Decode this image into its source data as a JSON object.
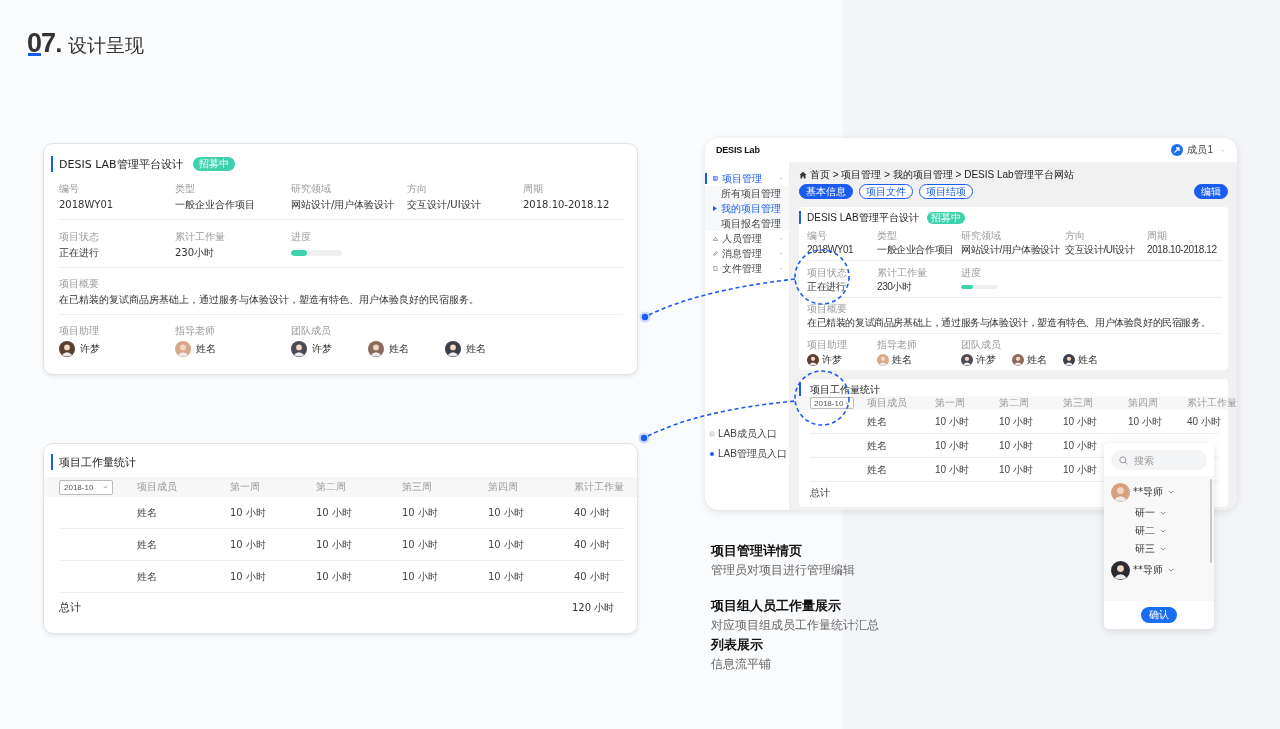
{
  "header": {
    "number": "07",
    "dot": ".",
    "title": "设计呈现"
  },
  "detail_card": {
    "title": "DESIS LAB管理平台设计",
    "badge": "招募中",
    "fields": [
      [
        {
          "kind": "text",
          "label": "编号",
          "value": "2018WY01"
        },
        {
          "kind": "text",
          "label": "类型",
          "value": "一般企业合作项目"
        },
        {
          "kind": "text",
          "label": "研究领域",
          "value": "网站设计/用户体验设计"
        },
        {
          "kind": "text",
          "label": "方向",
          "value": "交互设计/UI设计"
        },
        {
          "kind": "text",
          "label": "周期",
          "value": "2018.10-2018.12"
        }
      ],
      [
        {
          "kind": "text",
          "label": "项目状态",
          "value": "正在进行"
        },
        {
          "kind": "text",
          "label": "累计工作量",
          "value": "230小时"
        },
        {
          "kind": "progress",
          "label": "进度",
          "level": 0.32
        }
      ]
    ],
    "summary": {
      "label": "项目概要",
      "text": "在已精装的复试商品房基础上，通过服务与体验设计，塑造有特色、用户体验良好的民宿服务。"
    },
    "people": [
      {
        "label": "项目助理",
        "members": [
          {
            "name": "许梦"
          }
        ]
      },
      {
        "label": "指导老师",
        "members": [
          {
            "name": "姓名"
          }
        ]
      },
      {
        "label": "团队成员",
        "members": [
          {
            "name": "许梦"
          },
          {
            "name": "姓名"
          },
          {
            "name": "姓名"
          }
        ]
      }
    ]
  },
  "workload_card": {
    "title": "项目工作量统计",
    "month": "2018-10",
    "columns": [
      "项目成员",
      "第一周",
      "第二周",
      "第三周",
      "第四周",
      "累计工作量"
    ],
    "rows": [
      {
        "member": "姓名",
        "weeks": [
          "10 小时",
          "10 小时",
          "10 小时",
          "10 小时"
        ],
        "total": "40 小时"
      },
      {
        "member": "姓名",
        "weeks": [
          "10 小时",
          "10 小时",
          "10 小时",
          "10 小时"
        ],
        "total": "40 小时"
      },
      {
        "member": "姓名",
        "weeks": [
          "10 小时",
          "10 小时",
          "10 小时",
          "10 小时"
        ],
        "total": "40 小时"
      }
    ],
    "total_label": "总计",
    "total_value": "120 小时"
  },
  "app": {
    "logo": "DESIS Lab",
    "user": "成员1",
    "menu": [
      {
        "label": "项目管理",
        "selected": true,
        "expanded": true,
        "children": [
          {
            "label": "所有项目管理",
            "selected": false
          },
          {
            "label": "我的项目管理",
            "selected": true
          },
          {
            "label": "项目报名管理",
            "selected": false
          }
        ]
      },
      {
        "label": "人员管理",
        "selected": false,
        "expanded": false
      },
      {
        "label": "消息管理",
        "selected": false,
        "expanded": false
      },
      {
        "label": "文件管理",
        "selected": false,
        "expanded": false
      }
    ],
    "entries": [
      {
        "label": "LAB成员入口",
        "selected": false
      },
      {
        "label": "LAB管理员入口",
        "selected": true
      }
    ],
    "breadcrumb": "首页 > 项目管理 > 我的项目管理 > DESIS Lab管理平台网站",
    "tabs": [
      {
        "label": "基本信息",
        "selected": true
      },
      {
        "label": "项目文件",
        "selected": false
      },
      {
        "label": "项目结项",
        "selected": false
      }
    ],
    "edit_button": "编辑",
    "detail_card": {
      "title": "DESIS LAB管理平台设计",
      "badge": "招募中",
      "fields": [
        [
          {
            "kind": "text",
            "label": "编号",
            "value": "2018WY01"
          },
          {
            "kind": "text",
            "label": "类型",
            "value": "一般企业合作项目"
          },
          {
            "kind": "text",
            "label": "研究领域",
            "value": "网站设计/用户体验设计"
          },
          {
            "kind": "text",
            "label": "方向",
            "value": "交互设计/UI设计"
          },
          {
            "kind": "text",
            "label": "周期",
            "value": "2018.10-2018.12"
          }
        ],
        [
          {
            "kind": "text",
            "label": "项目状态",
            "value": "正在进行"
          },
          {
            "kind": "text",
            "label": "累计工作量",
            "value": "230小时"
          },
          {
            "kind": "progress",
            "label": "进度",
            "level": 0.32
          }
        ]
      ],
      "summary": {
        "label": "项目概要",
        "text": "在已精装的复试商品房基础上，通过服务与体验设计，塑造有特色、用户体验良好的民宿服务。"
      },
      "people": [
        {
          "label": "项目助理",
          "members": [
            {
              "name": "许梦"
            }
          ]
        },
        {
          "label": "指导老师",
          "members": [
            {
              "name": "姓名"
            }
          ]
        },
        {
          "label": "团队成员",
          "members": [
            {
              "name": "许梦"
            },
            {
              "name": "姓名"
            },
            {
              "name": "姓名"
            }
          ]
        }
      ]
    },
    "workload_card": {
      "title": "项目工作量统计",
      "month": "2018-10",
      "columns": [
        "项目成员",
        "第一周",
        "第二周",
        "第三周",
        "第四周",
        "累计工作量"
      ],
      "rows": [
        {
          "member": "姓名",
          "weeks": [
            "10 小时",
            "10 小时",
            "10 小时",
            "10 小时"
          ],
          "total": "40 小时"
        },
        {
          "member": "姓名",
          "weeks": [
            "10 小时",
            "10 小时",
            "10 小时"
          ]
        },
        {
          "member": "姓名",
          "weeks": [
            "10 小时",
            "10 小时",
            "10 小时"
          ]
        }
      ],
      "total_label": "总计"
    }
  },
  "member_picker": {
    "search_placeholder": "搜索",
    "teachers": [
      {
        "name": "**导师",
        "children": [
          {
            "label": "研一"
          },
          {
            "label": "研二"
          },
          {
            "label": "研三"
          }
        ]
      },
      {
        "name": "**导师"
      }
    ],
    "confirm": "确认"
  },
  "captions": [
    {
      "title": "项目管理详情页",
      "text": "管理员对项目进行管理编辑"
    },
    {
      "title": "项目组人员工作量展示",
      "text": "对应项目组成员工作量统计汇总"
    },
    {
      "title": "列表展示",
      "text": "信息流平铺"
    }
  ]
}
